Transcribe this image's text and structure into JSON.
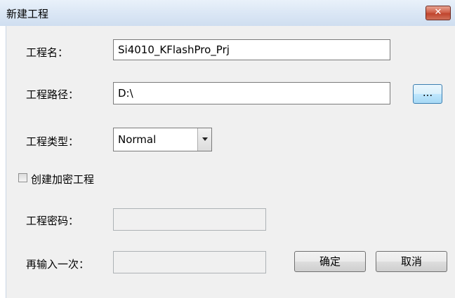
{
  "window": {
    "title": "新建工程",
    "close_label": "✕"
  },
  "form": {
    "project_name_label": "工程名：",
    "project_name_value": "Si4010_KFlashPro_Prj",
    "project_path_label": "工程路径：",
    "project_path_value": "D:\\",
    "browse_label": "...",
    "project_type_label": "工程类型：",
    "project_type_value": "Normal",
    "encrypt_checkbox_label": "创建加密工程",
    "encrypt_checked": false,
    "password_label": "工程密码：",
    "password_value": "",
    "confirm_password_label": "再输入一次：",
    "confirm_password_value": ""
  },
  "buttons": {
    "ok_label": "确定",
    "cancel_label": "取消"
  }
}
